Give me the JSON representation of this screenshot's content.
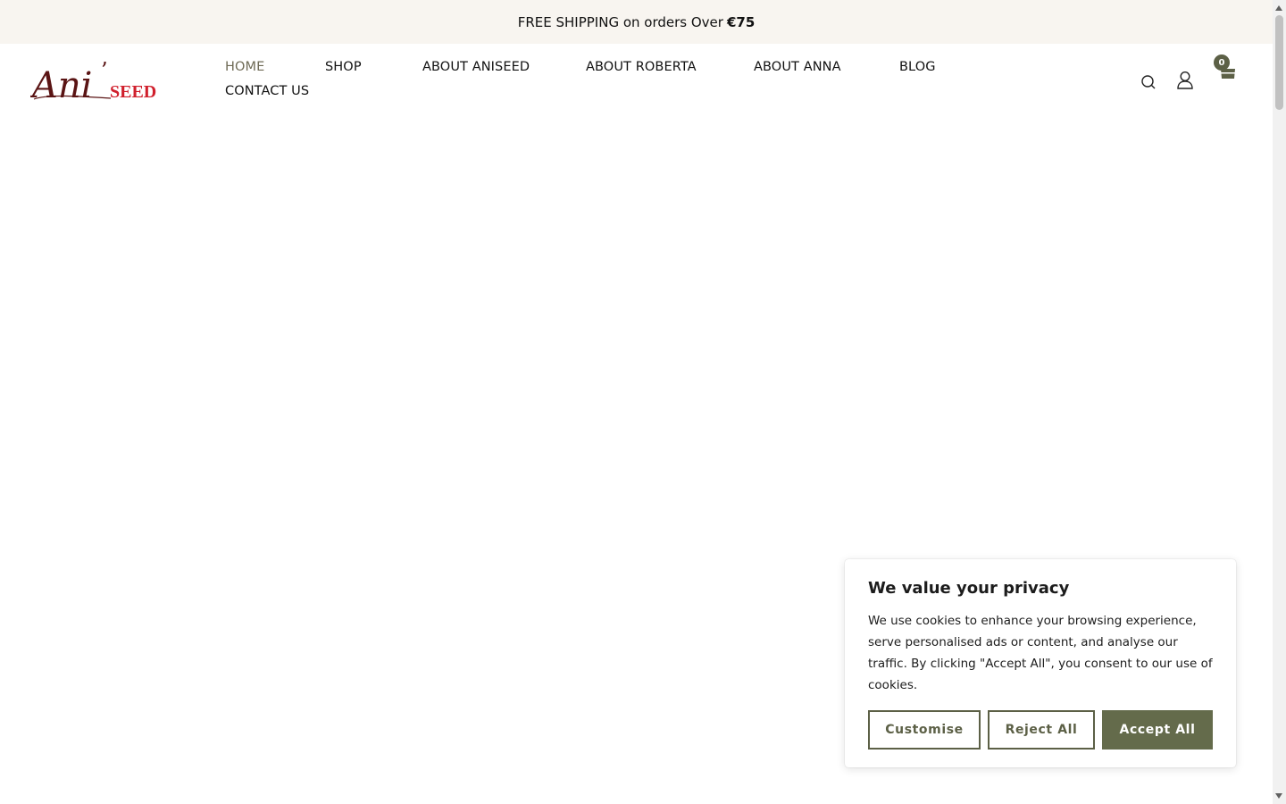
{
  "announcement": {
    "text": "FREE SHIPPING on orders Over",
    "amount": "€75"
  },
  "logo": {
    "script_text": "Ani",
    "mark": "’",
    "word": "SEED"
  },
  "nav": {
    "items": [
      {
        "label": "HOME",
        "active": true
      },
      {
        "label": "SHOP"
      },
      {
        "label": "ABOUT ANISEED"
      },
      {
        "label": "ABOUT ROBERTA"
      },
      {
        "label": "ABOUT ANNA"
      },
      {
        "label": "BLOG"
      },
      {
        "label": "CONTACT US"
      }
    ]
  },
  "header_icons": {
    "search": "search-icon",
    "account": "user-icon",
    "cart": "cart-icon",
    "cart_count": "0"
  },
  "cookie": {
    "title": "We value your privacy",
    "text": "We use cookies to enhance your browsing experience, serve personalised ads or content, and analyse our traffic. By clicking \"Accept All\", you consent to our use of cookies.",
    "customise": "Customise",
    "reject": "Reject All",
    "accept": "Accept All"
  },
  "colors": {
    "accent": "#646b4b",
    "active_nav": "#6e6a55",
    "announce_bg": "#f8f5f0",
    "logo_dark": "#5a1414",
    "logo_red": "#d01f2c"
  }
}
